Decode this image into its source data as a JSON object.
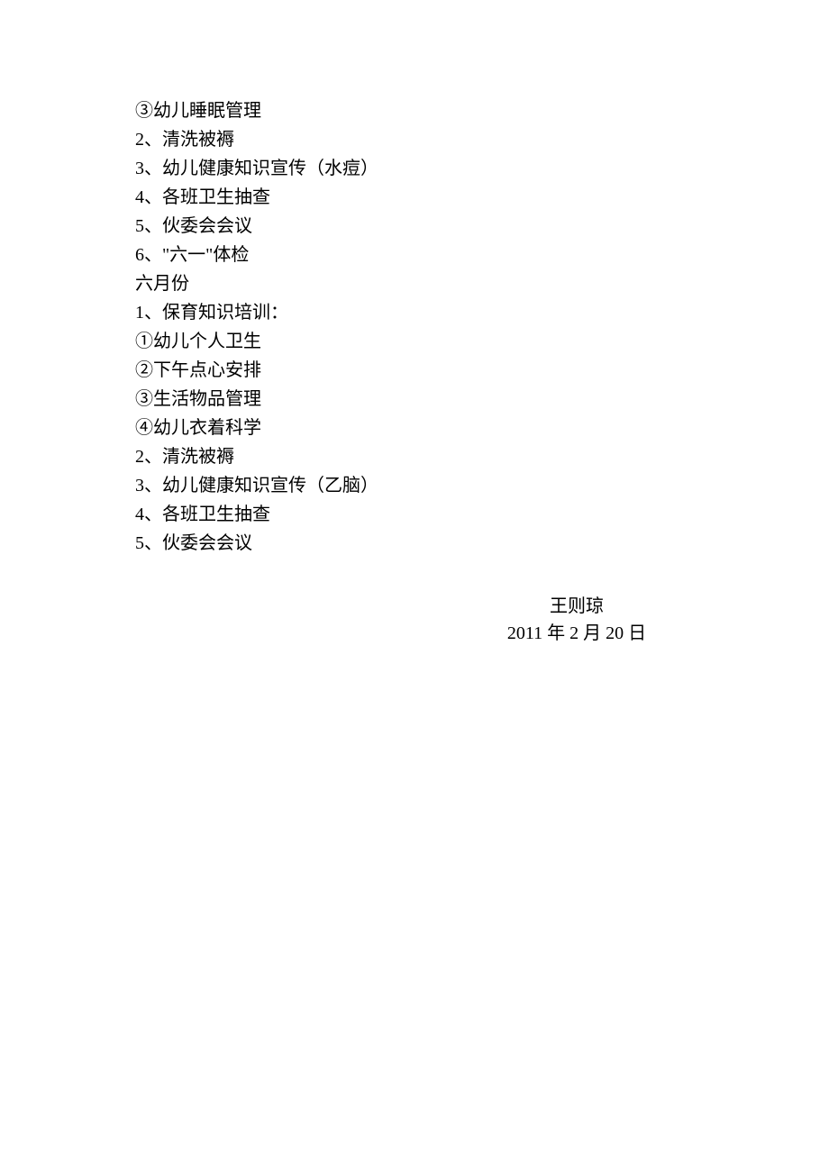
{
  "lines": [
    "③幼儿睡眠管理",
    "2、清洗被褥",
    "3、幼儿健康知识宣传（水痘）",
    "4、各班卫生抽查",
    "5、伙委会会议",
    "6、\"六一\"体检",
    "六月份",
    "1、保育知识培训：",
    "①幼儿个人卫生",
    "②下午点心安排",
    "③生活物品管理",
    "④幼儿衣着科学",
    "2、清洗被褥",
    "3、幼儿健康知识宣传（乙脑）",
    "4、各班卫生抽查",
    "5、伙委会会议"
  ],
  "signature": {
    "name": "王则琼",
    "date": "2011 年 2 月 20 日"
  }
}
